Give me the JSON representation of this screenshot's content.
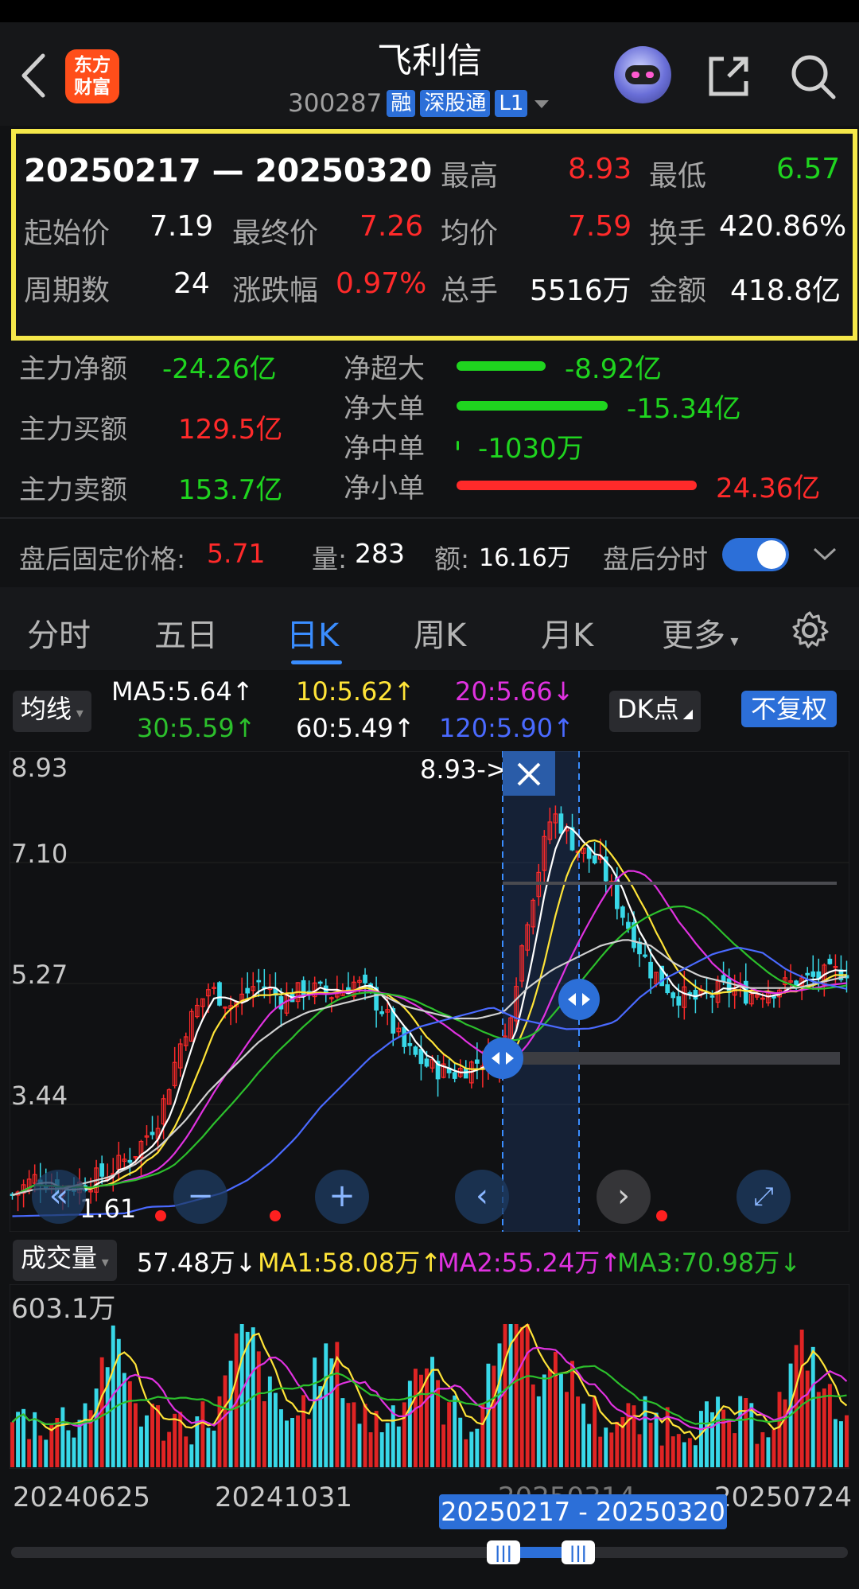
{
  "header": {
    "title": "飞利信",
    "code": "300287",
    "tags": [
      "融",
      "深股通",
      "L1"
    ],
    "logo_text": [
      "东方",
      "财富"
    ]
  },
  "range_stats": {
    "period": "20250217 — 20250320",
    "high_label": "最高",
    "high": "8.93",
    "low_label": "最低",
    "low": "6.57",
    "start_label": "起始价",
    "start": "7.19",
    "end_label": "最终价",
    "end": "7.26",
    "avg_label": "均价",
    "avg": "7.59",
    "turnover_label": "换手",
    "turnover": "420.86%",
    "periods_label": "周期数",
    "periods": "24",
    "change_label": "涨跌幅",
    "change": "0.97%",
    "volume_label": "总手",
    "volume": "5516万",
    "amount_label": "金额",
    "amount": "418.8亿"
  },
  "capital_flow": {
    "net_label": "主力净额",
    "net": "-24.26亿",
    "buy_label": "主力买额",
    "buy": "129.5亿",
    "sell_label": "主力卖额",
    "sell": "153.7亿",
    "items": [
      {
        "label": "净超大",
        "value": "-8.92亿",
        "fraction": 0.37,
        "color": "#1fd41f"
      },
      {
        "label": "净大单",
        "value": "-15.34亿",
        "fraction": 0.63,
        "color": "#1fd41f"
      },
      {
        "label": "净中单",
        "value": "-1030万",
        "fraction": 0.01,
        "color": "#1fd41f"
      },
      {
        "label": "净小单",
        "value": "24.36亿",
        "fraction": 1.0,
        "color": "#ff2a2a"
      }
    ]
  },
  "after_hours": {
    "price_label": "盘后固定价格:",
    "price": "5.71",
    "qty_label": "量:",
    "qty": "283",
    "amt_label": "额:",
    "amt": "16.16万",
    "toggle_label": "盘后分时",
    "toggle_on": true
  },
  "tabs": [
    "分时",
    "五日",
    "日K",
    "周K",
    "月K",
    "更多"
  ],
  "active_tab": "日K",
  "indicators": {
    "ma_selector": "均线",
    "ma5": "MA5:5.64↑",
    "ma10": "10:5.62↑",
    "ma20": "20:5.66↓",
    "ma30": "30:5.59↑",
    "ma60": "60:5.49↑",
    "ma120": "120:5.90↑",
    "dk_button": "DK点",
    "adjust_button": "不复权"
  },
  "chart_labels": {
    "y_ticks": [
      "8.93",
      "7.10",
      "5.27",
      "3.44"
    ],
    "low_marker": "1.61",
    "high_marker": "8.93->"
  },
  "volume_panel": {
    "selector": "成交量",
    "current": "57.48万↓",
    "ma1": "MA1:58.08万↑",
    "ma2": "MA2:55.24万↑",
    "ma3": "MA3:70.98万↓",
    "max_label": "603.1万"
  },
  "date_axis": [
    "20240625",
    "20241031",
    "20250314",
    "20250724"
  ],
  "selected_range": "20250217 - 20250320",
  "colors": {
    "up": "#ff2a2a",
    "down": "#1fd41f",
    "accent": "#2c6fd8",
    "ma5": "#ffffff",
    "ma10": "#ffe438",
    "ma20": "#e032e0",
    "ma30": "#2cc02c",
    "ma60": "#d0d0d0",
    "ma120": "#4a6aff",
    "highlight_box": "#f5e84a"
  },
  "chart_data": {
    "type": "candlestick",
    "y_range": [
      1.61,
      8.93
    ],
    "close_approx": [
      1.9,
      2.2,
      2.0,
      2.1,
      2.3,
      2.6,
      3.2,
      4.6,
      5.3,
      5.0,
      5.4,
      5.1,
      5.3,
      5.2,
      5.4,
      5.0,
      4.3,
      4.0,
      3.9,
      4.1,
      4.3,
      6.5,
      8.2,
      7.6,
      7.3,
      6.4,
      5.6,
      5.2,
      5.1,
      5.3,
      5.2,
      5.3,
      5.4,
      5.5,
      5.6
    ],
    "ma60_approx": [
      1.9,
      2.0,
      2.0,
      2.1,
      2.2,
      2.4,
      2.7,
      3.1,
      3.6,
      4.0,
      4.4,
      4.7,
      4.9,
      5.0,
      5.1,
      5.2,
      5.0,
      4.9,
      4.8,
      4.8,
      4.9,
      5.3,
      5.6,
      5.8,
      6.0,
      6.1,
      6.0,
      5.7,
      5.5,
      5.4,
      5.3,
      5.3,
      5.3,
      5.4,
      5.49
    ]
  }
}
